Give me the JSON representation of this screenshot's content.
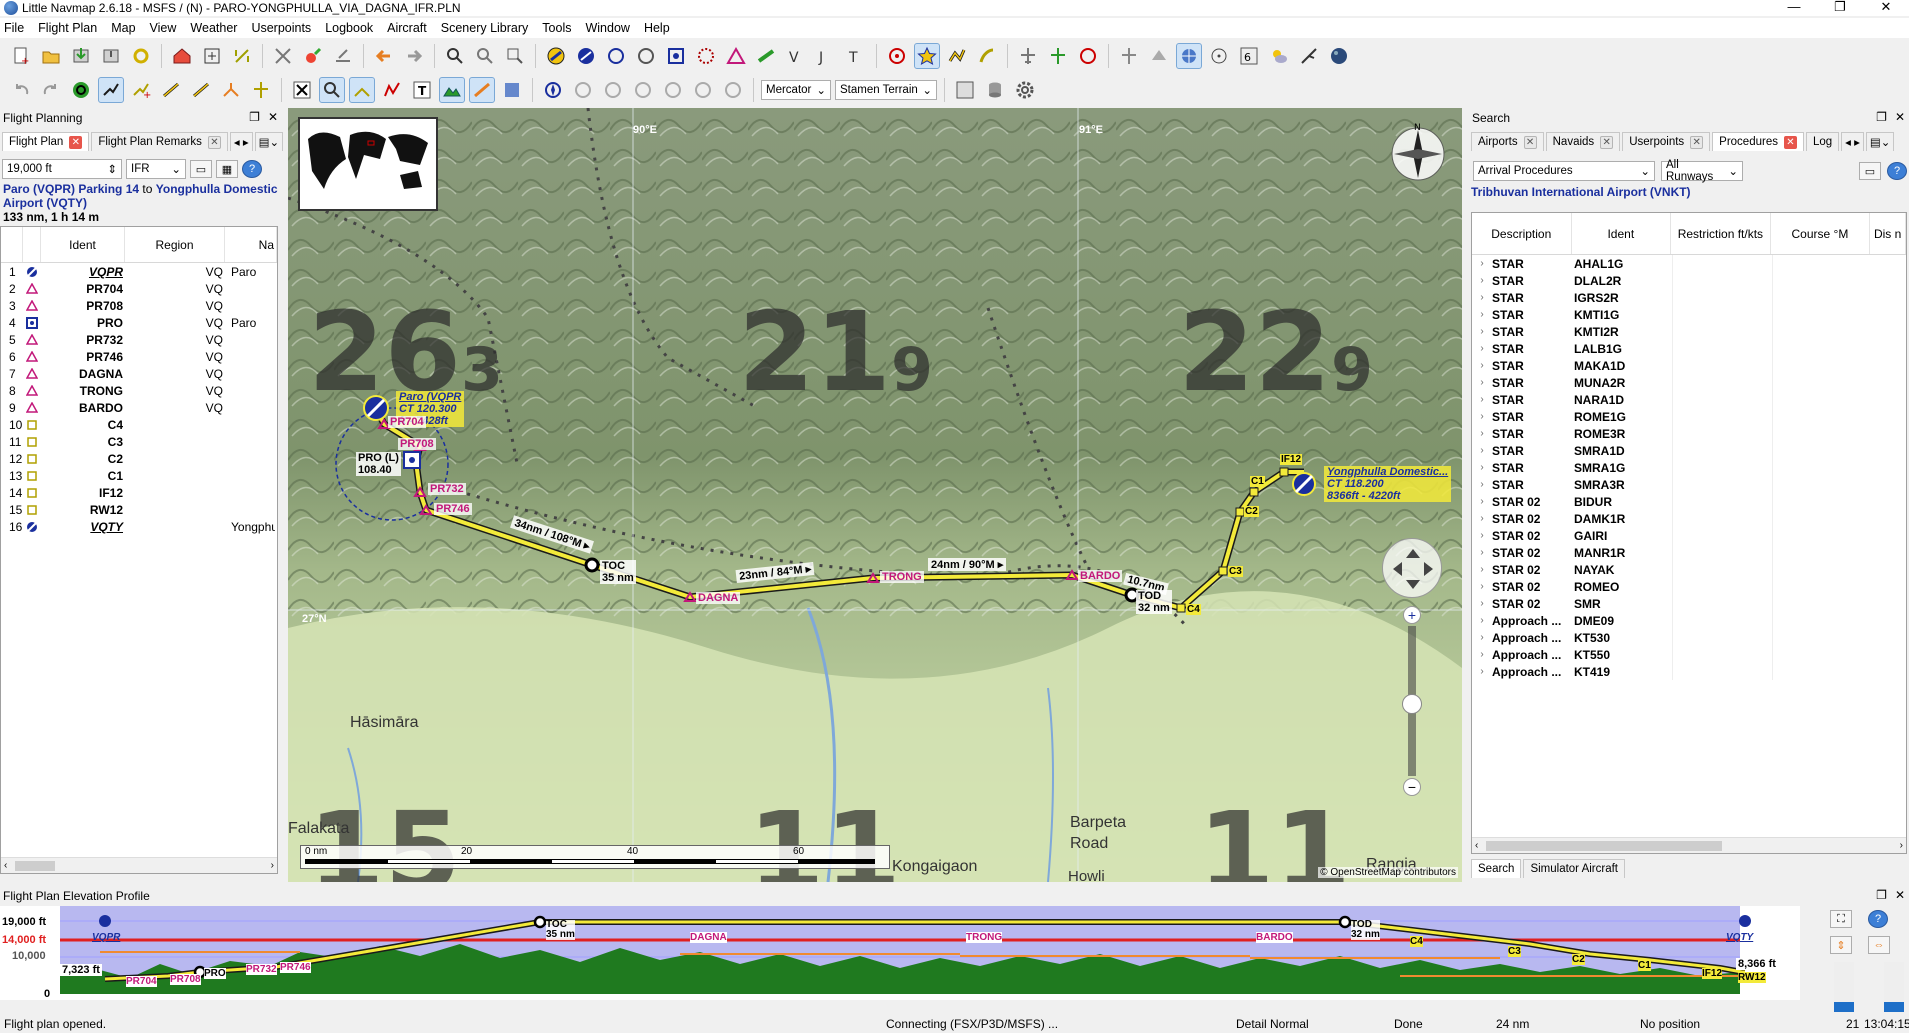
{
  "window": {
    "title": "Little Navmap 2.6.18 - MSFS / (N) - PARO-YONGPHULLA_VIA_DAGNA_IFR.PLN",
    "controls": [
      "—",
      "❐",
      "✕"
    ]
  },
  "menu": [
    "File",
    "Flight Plan",
    "Map",
    "View",
    "Weather",
    "Userpoints",
    "Logbook",
    "Aircraft",
    "Scenery Library",
    "Tools",
    "Window",
    "Help"
  ],
  "toolbar": {
    "projection": "Mercator",
    "theme": "Stamen Terrain"
  },
  "flight_planning": {
    "panel_title": "Flight Planning",
    "tabs": [
      {
        "label": "Flight Plan",
        "active": true
      },
      {
        "label": "Flight Plan Remarks",
        "active": false
      }
    ],
    "altitude_value": "19,000 ft",
    "type_value": "IFR",
    "route_from": "Paro (VQPR) Parking 14",
    "route_to_word": "to",
    "route_to": "Yongphulla Domestic Airport (VQTY)",
    "route_info": "133 nm, 1 h 14 m",
    "columns": [
      "Ident",
      "Region",
      "Na"
    ],
    "rows": [
      {
        "no": "1",
        "icon": "airport",
        "ident": "VQPR",
        "region": "VQ",
        "name": "Paro"
      },
      {
        "no": "2",
        "icon": "waypoint",
        "ident": "PR704",
        "region": "VQ",
        "name": ""
      },
      {
        "no": "3",
        "icon": "waypoint",
        "ident": "PR708",
        "region": "VQ",
        "name": ""
      },
      {
        "no": "4",
        "icon": "vor",
        "ident": "PRO",
        "region": "VQ",
        "name": "Paro"
      },
      {
        "no": "5",
        "icon": "waypoint",
        "ident": "PR732",
        "region": "VQ",
        "name": ""
      },
      {
        "no": "6",
        "icon": "waypoint",
        "ident": "PR746",
        "region": "VQ",
        "name": ""
      },
      {
        "no": "7",
        "icon": "waypoint",
        "ident": "DAGNA",
        "region": "VQ",
        "name": ""
      },
      {
        "no": "8",
        "icon": "waypoint",
        "ident": "TRONG",
        "region": "VQ",
        "name": ""
      },
      {
        "no": "9",
        "icon": "waypoint",
        "ident": "BARDO",
        "region": "VQ",
        "name": ""
      },
      {
        "no": "10",
        "icon": "proc",
        "ident": "C4",
        "region": "",
        "name": ""
      },
      {
        "no": "11",
        "icon": "proc",
        "ident": "C3",
        "region": "",
        "name": ""
      },
      {
        "no": "12",
        "icon": "proc",
        "ident": "C2",
        "region": "",
        "name": ""
      },
      {
        "no": "13",
        "icon": "proc",
        "ident": "C1",
        "region": "",
        "name": ""
      },
      {
        "no": "14",
        "icon": "proc",
        "ident": "IF12",
        "region": "",
        "name": ""
      },
      {
        "no": "15",
        "icon": "proc",
        "ident": "RW12",
        "region": "",
        "name": ""
      },
      {
        "no": "16",
        "icon": "airport",
        "ident": "VQTY",
        "region": "",
        "name": "Yongphu"
      }
    ]
  },
  "map": {
    "grid_labels": {
      "lon1": "90°E",
      "lon2": "91°E",
      "lat": "27°N"
    },
    "msa": [
      {
        "big": "26",
        "small": "3"
      },
      {
        "big": "21",
        "small": "9"
      },
      {
        "big": "22",
        "small": "9"
      },
      {
        "big": "15",
        "small": ""
      },
      {
        "big": "11",
        "small": ""
      },
      {
        "big": "11",
        "small": ""
      }
    ],
    "places": [
      "Hāsimāra",
      "Falakata",
      "Barpeta",
      "Road",
      "Kongaigaon",
      "Howli",
      "Rangia"
    ],
    "origin_label": [
      "Paro (VQPR",
      "CT 120.300",
      "ft - 7428ft"
    ],
    "dest_label": [
      "Yongphulla Domestic...",
      "CT 118.200",
      "8366ft - 4220ft"
    ],
    "vor_label": [
      "PRO (L)",
      "108.40"
    ],
    "legs": [
      "34nm / 108°M ▸",
      "23nm / 84°M ▸",
      "24nm / 90°M ▸",
      "10.7nm"
    ],
    "toc": [
      "TOC",
      "35 nm"
    ],
    "tod": [
      "TOD",
      "32 nm"
    ],
    "scale": [
      "0 nm",
      "20",
      "40",
      "60"
    ],
    "attribution": "© OpenStreetMap contributors"
  },
  "search": {
    "panel_title": "Search",
    "tabs": [
      {
        "label": "Airports",
        "active": false
      },
      {
        "label": "Navaids",
        "active": false
      },
      {
        "label": "Userpoints",
        "active": false
      },
      {
        "label": "Procedures",
        "active": true
      },
      {
        "label": "Log",
        "active": false
      }
    ],
    "filter1": "Arrival Procedures",
    "filter2": "All Runways",
    "airport": "Tribhuvan International Airport (VNKT)",
    "columns": [
      "Description",
      "Ident",
      "Restriction ft/kts",
      "Course °M",
      "Dis n"
    ],
    "rows": [
      [
        "STAR",
        "AHAL1G"
      ],
      [
        "STAR",
        "DLAL2R"
      ],
      [
        "STAR",
        "IGRS2R"
      ],
      [
        "STAR",
        "KMTI1G"
      ],
      [
        "STAR",
        "KMTI2R"
      ],
      [
        "STAR",
        "LALB1G"
      ],
      [
        "STAR",
        "MAKA1D"
      ],
      [
        "STAR",
        "MUNA2R"
      ],
      [
        "STAR",
        "NARA1D"
      ],
      [
        "STAR",
        "ROME1G"
      ],
      [
        "STAR",
        "ROME3R"
      ],
      [
        "STAR",
        "SMRA1D"
      ],
      [
        "STAR",
        "SMRA1G"
      ],
      [
        "STAR",
        "SMRA3R"
      ],
      [
        "STAR 02",
        "BIDUR"
      ],
      [
        "STAR 02",
        "DAMK1R"
      ],
      [
        "STAR 02",
        "GAIRI"
      ],
      [
        "STAR 02",
        "MANR1R"
      ],
      [
        "STAR 02",
        "NAYAK"
      ],
      [
        "STAR 02",
        "ROMEO"
      ],
      [
        "STAR 02",
        "SMR"
      ],
      [
        "Approach ...",
        "DME09"
      ],
      [
        "Approach ...",
        "KT530"
      ],
      [
        "Approach ...",
        "KT550"
      ],
      [
        "Approach ...",
        "KT419"
      ]
    ],
    "bottom_tabs": [
      "Search",
      "Simulator Aircraft"
    ]
  },
  "elevation": {
    "panel_title": "Flight Plan Elevation Profile",
    "alt_labels": [
      "19,000 ft",
      "14,000 ft",
      "10,000",
      "0"
    ],
    "start_elev": "7,323 ft",
    "end_elev": "8,366 ft",
    "points": [
      "VQPR",
      "PR704",
      "PR708",
      "PRO",
      "PR732",
      "PR746",
      "TOC",
      "35 nm",
      "DAGNA",
      "TRONG",
      "BARDO",
      "TOD",
      "32 nm",
      "C4",
      "C3",
      "C2",
      "C1",
      "IF12",
      "RW12",
      "VQTY"
    ]
  },
  "status": {
    "message": "Flight plan opened.",
    "connection": "Connecting (FSX/P3D/MSFS) ...",
    "detail": "Detail Normal",
    "state": "Done",
    "distance": "24 nm",
    "position": "No position",
    "count": "21",
    "time": "13:04:15"
  },
  "colors": {
    "route": "#f3ea3a",
    "waypoint": "#c2187a",
    "accent": "#1a2f9e",
    "terrain": "#1f7a1f",
    "profile_bg": "#b8b8f0"
  }
}
